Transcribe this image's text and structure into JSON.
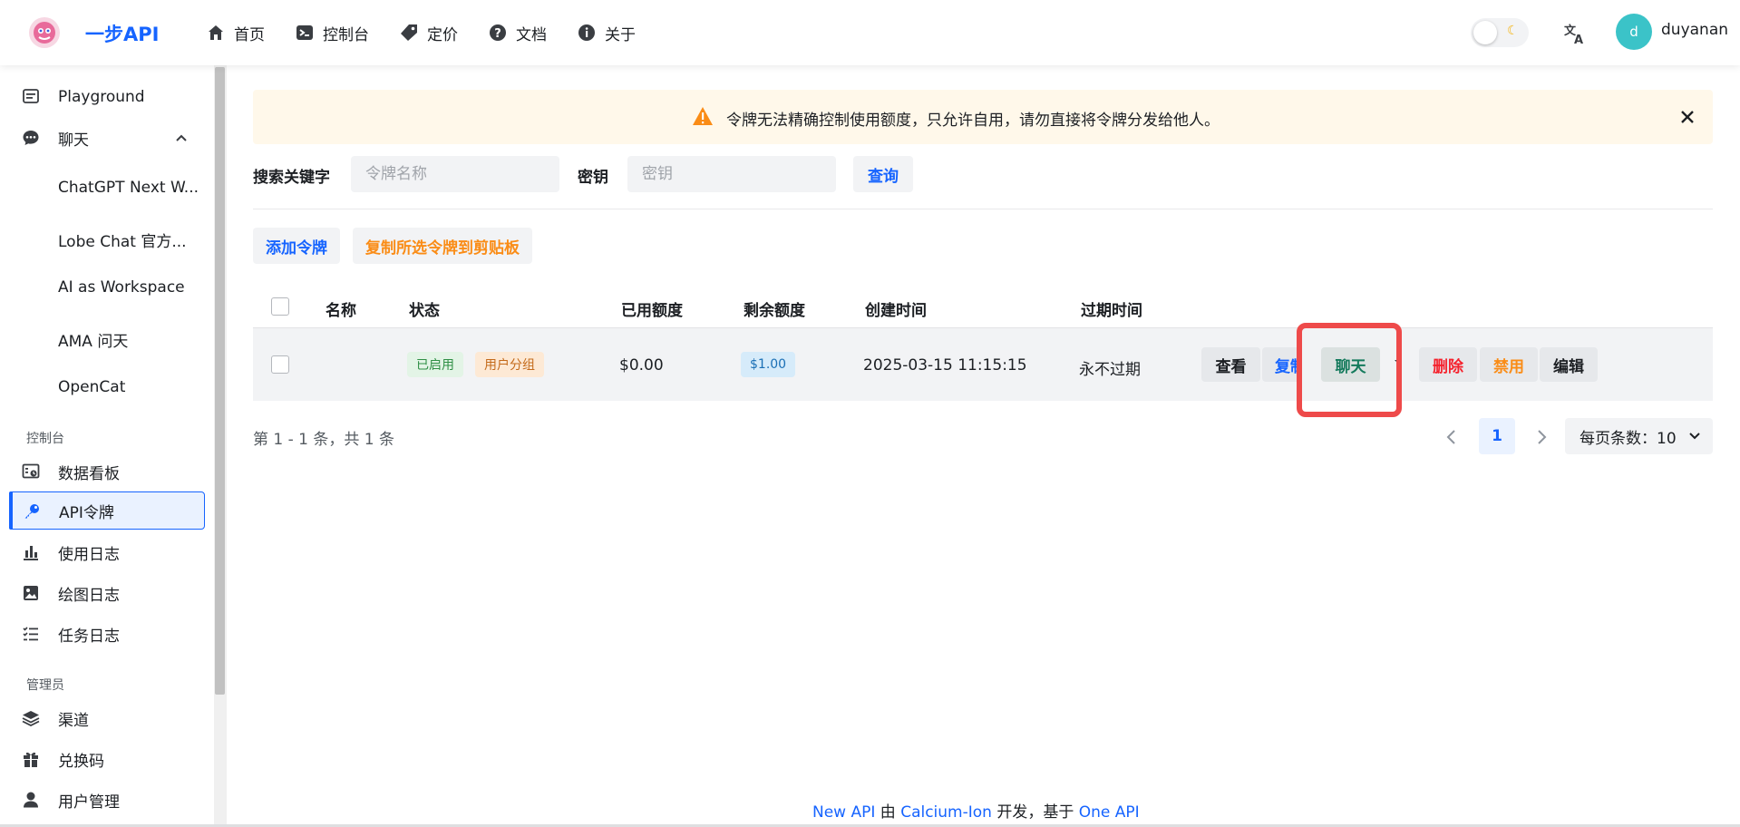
{
  "header": {
    "brand": "一步API",
    "nav": [
      {
        "label": "首页",
        "icon": "home-icon"
      },
      {
        "label": "控制台",
        "icon": "terminal-icon"
      },
      {
        "label": "定价",
        "icon": "price-tag-icon"
      },
      {
        "label": "文档",
        "icon": "help-circle-icon"
      },
      {
        "label": "关于",
        "icon": "info-circle-icon"
      }
    ],
    "avatar_letter": "d",
    "username": "duyanan"
  },
  "sidebar": {
    "items_top": [
      {
        "label": "Playground",
        "icon": "chat-box-icon"
      },
      {
        "label": "聊天",
        "icon": "comment-icon"
      }
    ],
    "chat_sub": [
      "ChatGPT Next W...",
      "Lobe Chat 官方...",
      "AI as Workspace",
      "AMA 问天",
      "OpenCat"
    ],
    "group_console": "控制台",
    "console_items": [
      {
        "label": "数据看板",
        "icon": "dashboard-icon"
      },
      {
        "label": "API令牌",
        "icon": "key-icon"
      },
      {
        "label": "使用日志",
        "icon": "bar-chart-icon"
      },
      {
        "label": "绘图日志",
        "icon": "image-icon"
      },
      {
        "label": "任务日志",
        "icon": "task-list-icon"
      }
    ],
    "group_admin": "管理员",
    "admin_items": [
      {
        "label": "渠道",
        "icon": "layers-icon"
      },
      {
        "label": "兑换码",
        "icon": "gift-icon"
      },
      {
        "label": "用户管理",
        "icon": "user-icon"
      }
    ]
  },
  "banner": {
    "text": "令牌无法精确控制使用额度，只允许自用，请勿直接将令牌分发给他人。"
  },
  "search": {
    "label": "搜索关键字",
    "name_placeholder": "令牌名称",
    "key_label": "密钥",
    "key_placeholder": "密钥",
    "query_label": "查询"
  },
  "actions": {
    "add": "添加令牌",
    "copy_selected": "复制所选令牌到剪贴板"
  },
  "table": {
    "columns": [
      "名称",
      "状态",
      "已用额度",
      "剩余额度",
      "创建时间",
      "过期时间"
    ],
    "rows": [
      {
        "name": "",
        "status_tags": [
          "已启用",
          "用户分组"
        ],
        "used": "$0.00",
        "remaining": "$1.00",
        "created": "2025-03-15 11:15:15",
        "expires": "永不过期",
        "ops": {
          "view": "查看",
          "copy": "复制",
          "chat": "聊天",
          "delete": "删除",
          "disable": "禁用",
          "edit": "编辑"
        }
      }
    ]
  },
  "pagination": {
    "info": "第 1 - 1 条，共 1 条",
    "current": "1",
    "page_size": "每页条数：10"
  },
  "footer": {
    "p1": "New API",
    "p2": " 由 ",
    "p3": "Calcium-Ion",
    "p4": " 开发，基于 ",
    "p5": "One API"
  },
  "colors": {
    "accent": "#1664ff",
    "warning": "#fa8c16",
    "danger": "#f5222d",
    "success_tag_bg": "#e3f4e6",
    "highlight": "#ee4a4a"
  }
}
